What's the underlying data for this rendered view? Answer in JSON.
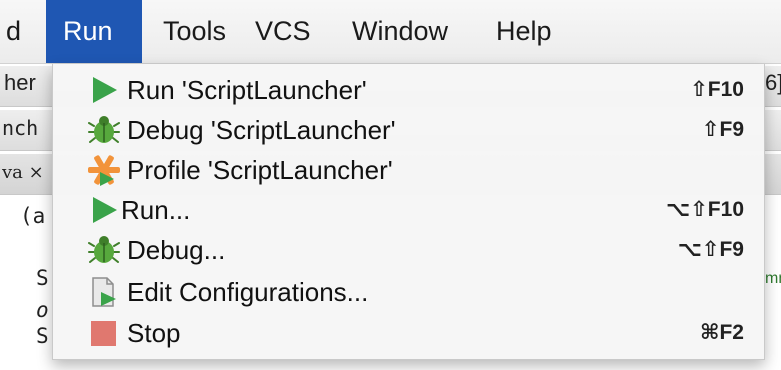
{
  "menubar": {
    "items": [
      {
        "label": "d"
      },
      {
        "label": "Run"
      },
      {
        "label": "Tools"
      },
      {
        "label": "VCS"
      },
      {
        "label": "Window"
      },
      {
        "label": "Help"
      }
    ]
  },
  "background": {
    "left_fragments": [
      "her",
      "nch",
      "va ×",
      "(a",
      "S",
      "o",
      "S"
    ],
    "right_fragments": [
      "6]",
      "mm"
    ]
  },
  "run_menu": {
    "items": [
      {
        "label": "Run 'ScriptLauncher'",
        "shortcut": "⇧F10",
        "icon": "run-icon"
      },
      {
        "label": "Debug 'ScriptLauncher'",
        "shortcut": "⇧F9",
        "icon": "debug-icon"
      },
      {
        "label": "Profile 'ScriptLauncher'",
        "shortcut": "",
        "icon": "profile-icon"
      },
      {
        "label": "Run...",
        "shortcut": "⌥⇧F10",
        "icon": "run-icon"
      },
      {
        "label": "Debug...",
        "shortcut": "⌥⇧F9",
        "icon": "debug-icon"
      },
      {
        "label": "Edit Configurations...",
        "shortcut": "",
        "icon": "edit-configurations-icon"
      },
      {
        "label": "Stop",
        "shortcut": "⌘F2",
        "icon": "stop-icon"
      }
    ]
  },
  "colors": {
    "menu_active": "#1f57b3",
    "run_green": "#3aa34a",
    "stop_red": "#e0786f",
    "profile_orange": "#f2933a"
  }
}
